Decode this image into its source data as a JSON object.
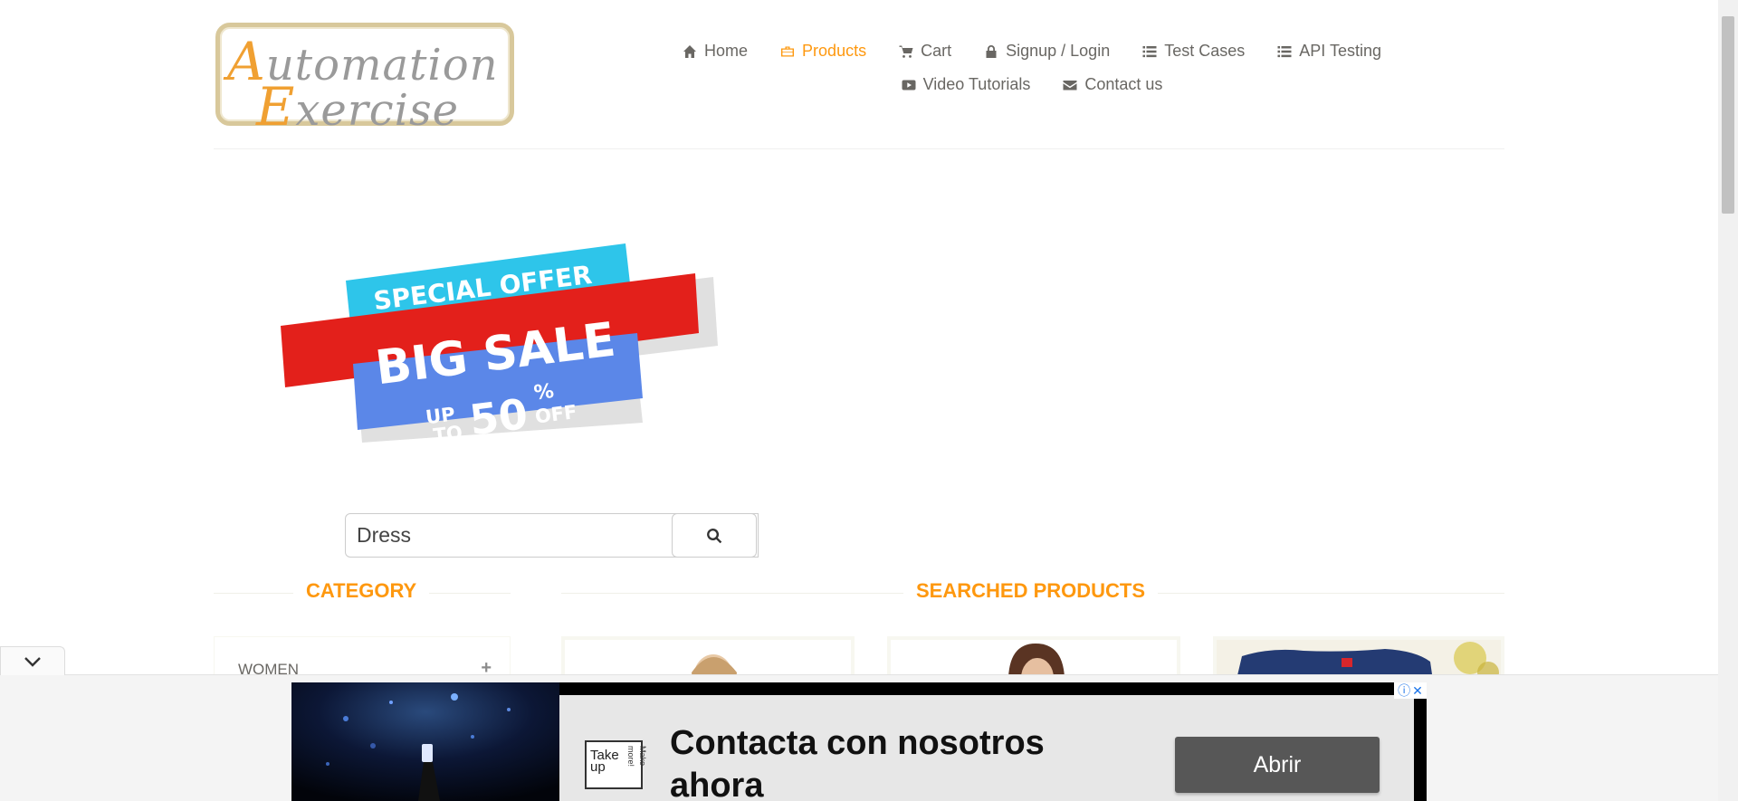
{
  "logo": {
    "line1_cap": "A",
    "line1_rest": "utomation",
    "line2_cap": "E",
    "line2_rest": "xercise"
  },
  "nav": {
    "items": [
      {
        "label": "Home",
        "icon": "home-icon",
        "active": false
      },
      {
        "label": "Products",
        "icon": "briefcase-icon",
        "active": true
      },
      {
        "label": "Cart",
        "icon": "cart-icon",
        "active": false
      },
      {
        "label": "Signup / Login",
        "icon": "lock-icon",
        "active": false
      },
      {
        "label": "Test Cases",
        "icon": "list-icon",
        "active": false
      },
      {
        "label": "API Testing",
        "icon": "list-icon",
        "active": false
      },
      {
        "label": "Video Tutorials",
        "icon": "youtube-icon",
        "active": false
      },
      {
        "label": "Contact us",
        "icon": "envelope-icon",
        "active": false
      }
    ]
  },
  "banner": {
    "top": "SPECIAL OFFER",
    "main": "BIG SALE",
    "up": "UP",
    "to": "TO",
    "amount": "50",
    "percent": "%",
    "off": "OFF"
  },
  "search": {
    "value": "Dress",
    "button_icon": "search-icon"
  },
  "sections": {
    "category_title": "CATEGORY",
    "products_title": "SEARCHED PRODUCTS"
  },
  "category": {
    "items": [
      {
        "label": "WOMEN",
        "toggle": "+"
      }
    ]
  },
  "ad": {
    "logo_line1": "Take",
    "logo_line2": "up",
    "logo_side": "Make more!",
    "headline": "Contacta con nosotros ahora",
    "cta": "Abrir",
    "info_icon": "ⓘ",
    "close_icon": "✕"
  },
  "colors": {
    "accent": "#fe980f",
    "text": "#696763",
    "banner_cyan": "#2ec5ea",
    "banner_red": "#e3201b",
    "banner_blue": "#5b87e8"
  }
}
